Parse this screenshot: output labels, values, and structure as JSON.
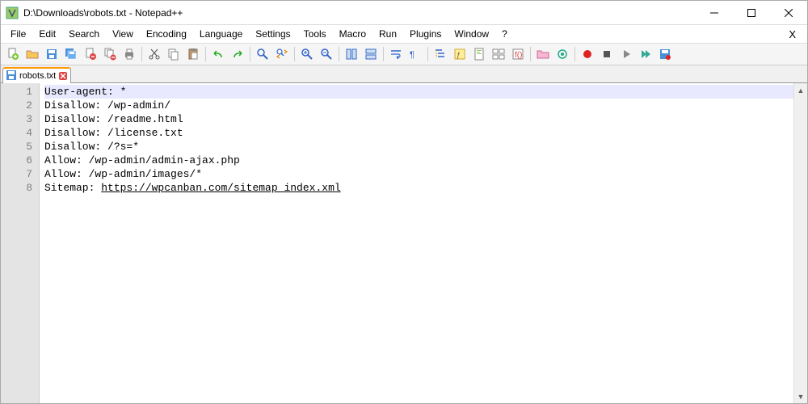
{
  "title": "D:\\Downloads\\robots.txt - Notepad++",
  "menu": [
    "File",
    "Edit",
    "Search",
    "View",
    "Encoding",
    "Language",
    "Settings",
    "Tools",
    "Macro",
    "Run",
    "Plugins",
    "Window",
    "?"
  ],
  "tab": {
    "label": "robots.txt"
  },
  "lines": [
    {
      "n": 1,
      "text": "User-agent: *",
      "current": true
    },
    {
      "n": 2,
      "text": "Disallow: /wp-admin/"
    },
    {
      "n": 3,
      "text": "Disallow: /readme.html"
    },
    {
      "n": 4,
      "text": "Disallow: /license.txt"
    },
    {
      "n": 5,
      "text": "Disallow: /?s=*"
    },
    {
      "n": 6,
      "text": "Allow: /wp-admin/admin-ajax.php"
    },
    {
      "n": 7,
      "text": "Allow: /wp-admin/images/*"
    },
    {
      "n": 8,
      "prefix": "Sitemap: ",
      "link": "https://wpcanban.com/sitemap_index.xml"
    }
  ],
  "toolbar_icons": [
    "new-file-icon",
    "open-file-icon",
    "save-icon",
    "save-all-icon",
    "close-icon",
    "close-all-icon",
    "print-icon",
    "sep",
    "cut-icon",
    "copy-icon",
    "paste-icon",
    "sep",
    "undo-icon",
    "redo-icon",
    "sep",
    "find-icon",
    "replace-icon",
    "sep",
    "zoom-in-icon",
    "zoom-out-icon",
    "sep",
    "sync-v-icon",
    "sync-h-icon",
    "sep",
    "wrap-icon",
    "whitespace-icon",
    "sep",
    "indent-guide-icon",
    "udlanguage-icon",
    "doc-map-icon",
    "doc-list-icon",
    "func-list-icon",
    "sep",
    "folder-icon",
    "monitor-icon",
    "sep",
    "record-icon",
    "stop-icon",
    "play-icon",
    "play-multi-icon",
    "save-macro-icon"
  ]
}
